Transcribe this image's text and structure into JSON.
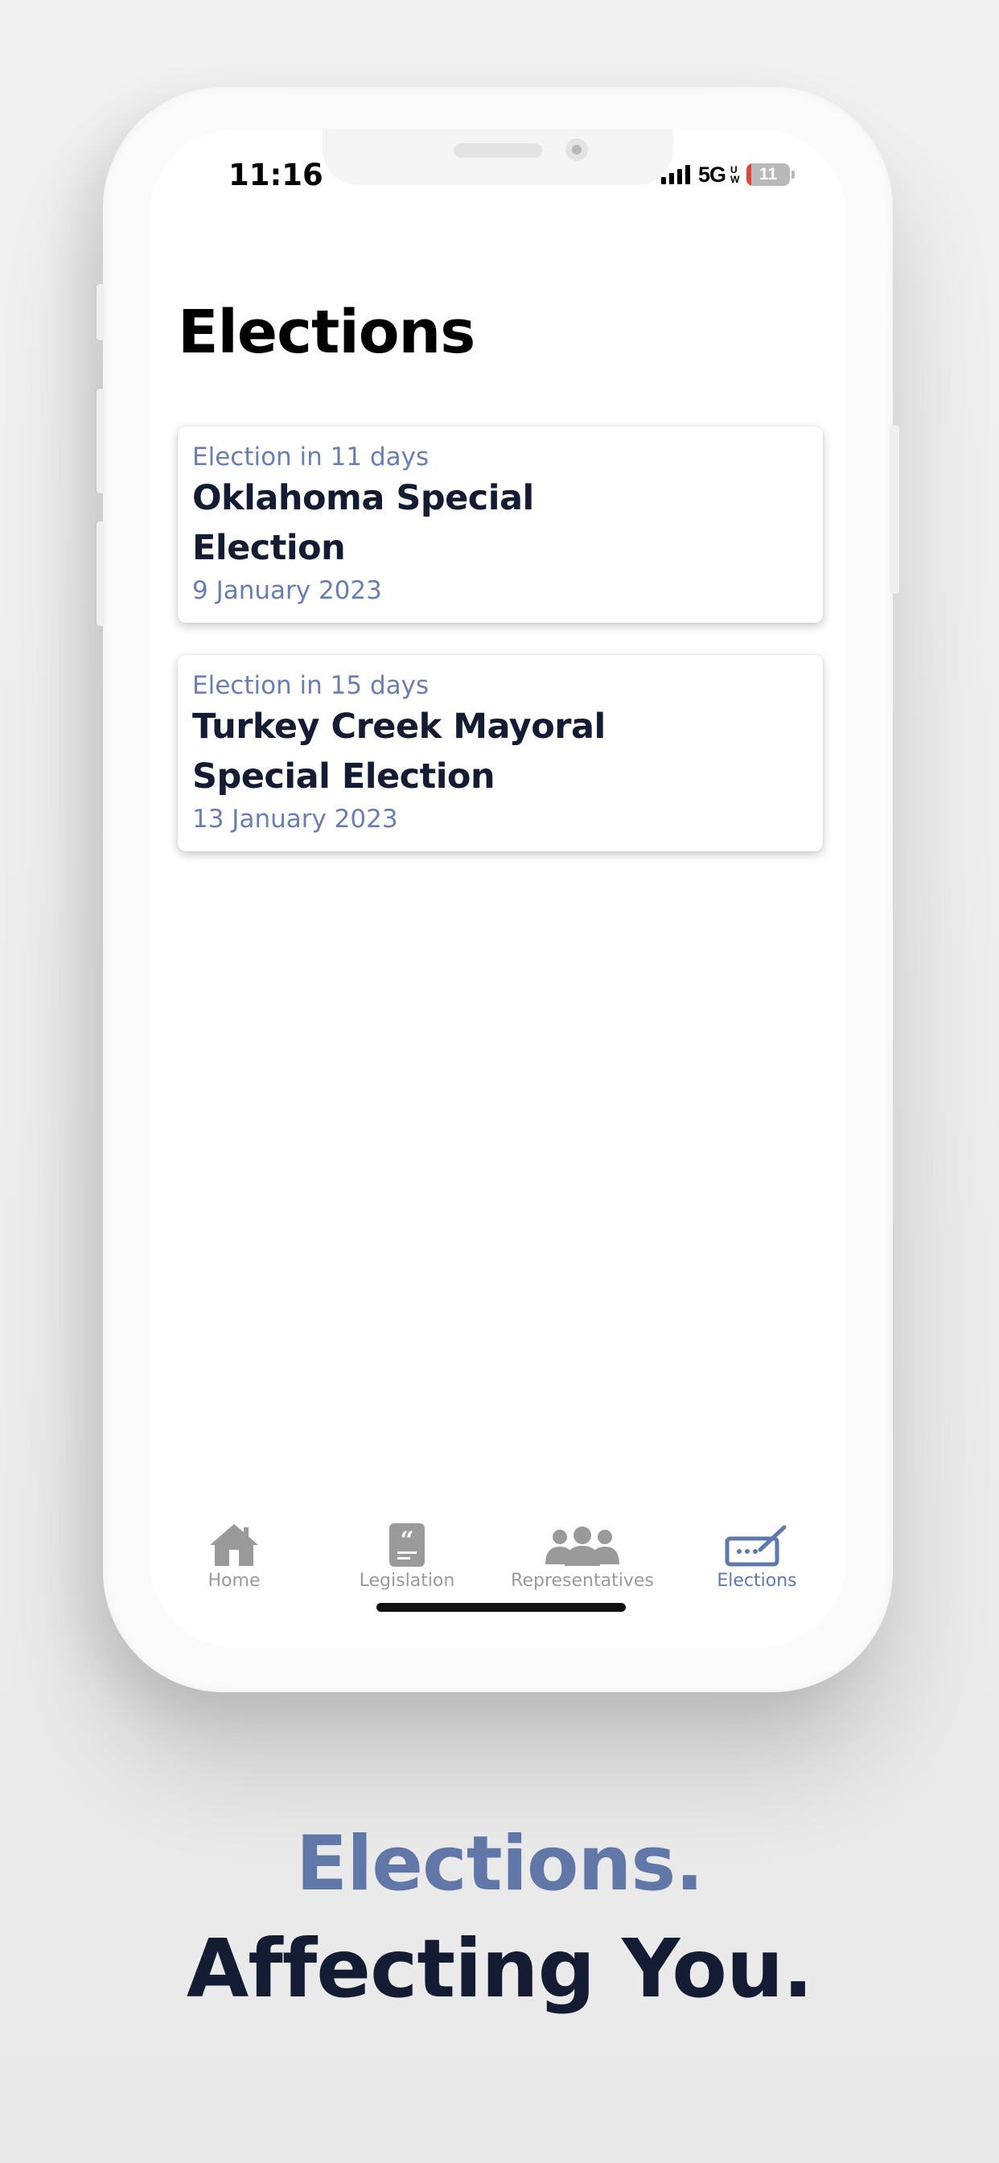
{
  "status_bar": {
    "time": "11:16",
    "network": "5G",
    "network_suffix": "UW",
    "battery_percent": "11"
  },
  "page": {
    "title": "Elections"
  },
  "elections": [
    {
      "countdown": "Election in 11 days",
      "name": "Oklahoma Special Election",
      "date": "9 January 2023"
    },
    {
      "countdown": "Election in 15 days",
      "name": "Turkey Creek Mayoral Special Election",
      "date": "13 January 2023"
    }
  ],
  "tabbar": {
    "tabs": [
      {
        "label": "Home",
        "icon": "home-icon",
        "active": false
      },
      {
        "label": "Legislation",
        "icon": "quote-document-icon",
        "active": false
      },
      {
        "label": "Representatives",
        "icon": "people-group-icon",
        "active": false
      },
      {
        "label": "Elections",
        "icon": "ballot-box-icon",
        "active": true
      }
    ]
  },
  "tagline": {
    "line1": "Elections.",
    "line2": "Affecting You."
  },
  "colors": {
    "accent": "#6077a8",
    "heading_dark": "#141c33",
    "inactive_tab": "#9a9a9a",
    "battery_low": "#e0473c"
  }
}
